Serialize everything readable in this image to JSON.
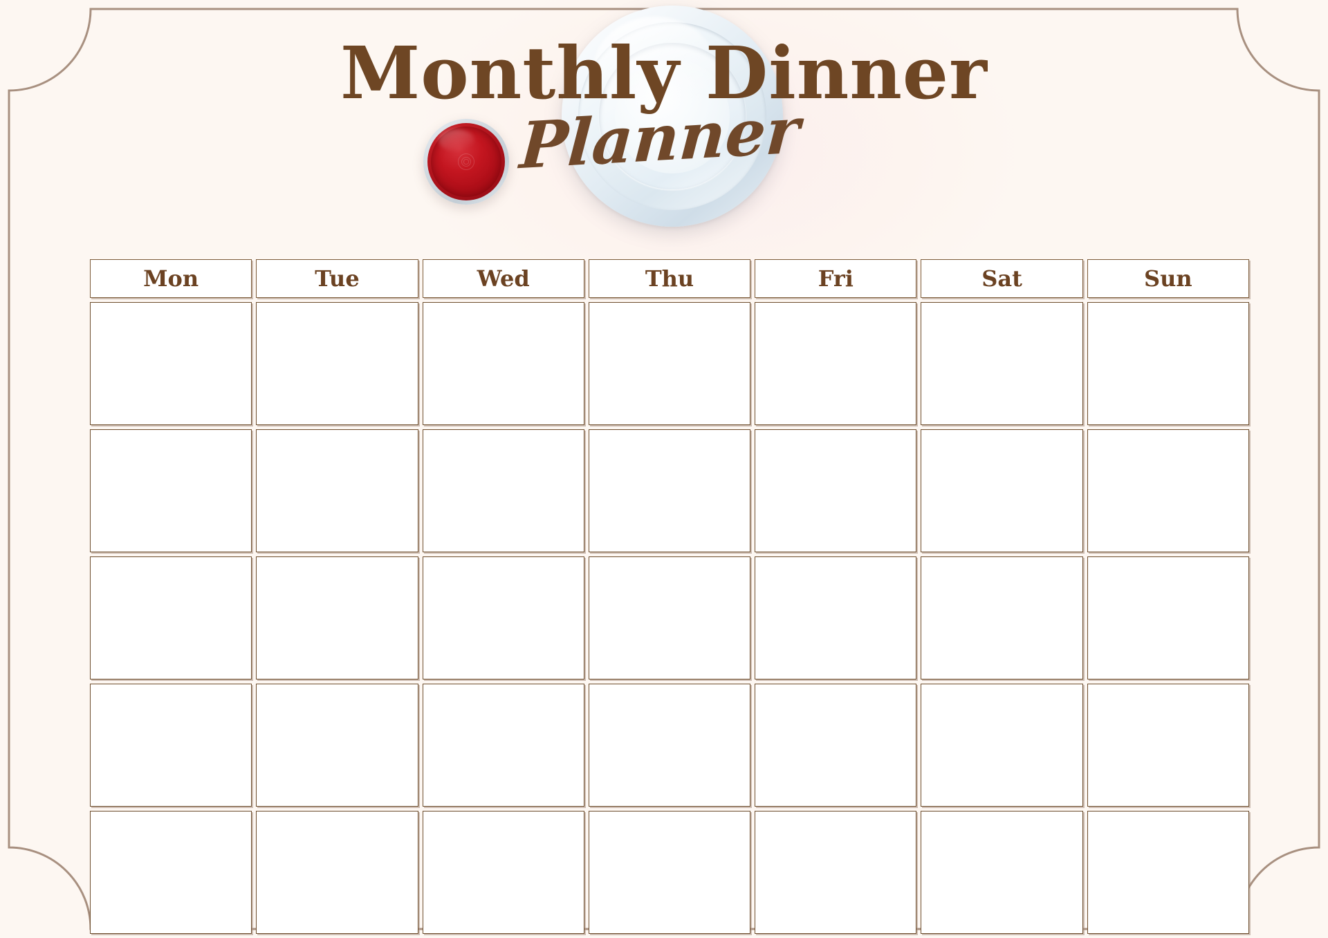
{
  "document": {
    "title_line1": "Monthly Dinner",
    "title_line2": "Planner",
    "theme": {
      "background": "#fdf7f2",
      "ink_brown": "#6e4624",
      "border_brown": "#7b5a37",
      "frame_line": "#a89080",
      "cell_fill": "#ffffff",
      "wine_red": "#c41620",
      "plate_blue": "#dbe7ef"
    }
  },
  "decor": {
    "frame_name": "notched-corner-frame",
    "plate_name": "dinner-plate-illustration",
    "wine_name": "wine-glass-illustration"
  },
  "calendar": {
    "weekdays": [
      {
        "label": "Mon"
      },
      {
        "label": "Tue"
      },
      {
        "label": "Wed"
      },
      {
        "label": "Thu"
      },
      {
        "label": "Fri"
      },
      {
        "label": "Sat"
      },
      {
        "label": "Sun"
      }
    ],
    "week_count": 5,
    "columns_per_week": 7,
    "cells": [
      [
        "",
        "",
        "",
        "",
        "",
        "",
        ""
      ],
      [
        "",
        "",
        "",
        "",
        "",
        "",
        ""
      ],
      [
        "",
        "",
        "",
        "",
        "",
        "",
        ""
      ],
      [
        "",
        "",
        "",
        "",
        "",
        "",
        ""
      ],
      [
        "",
        "",
        "",
        "",
        "",
        "",
        ""
      ]
    ]
  }
}
